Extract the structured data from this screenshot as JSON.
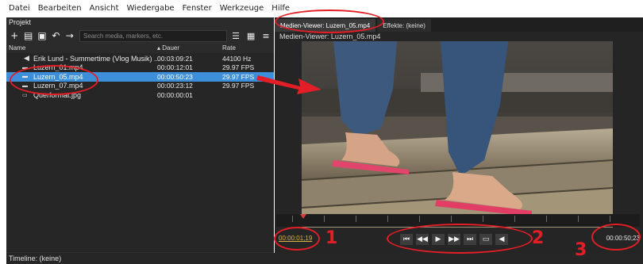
{
  "menu": [
    "Datei",
    "Bearbeiten",
    "Ansicht",
    "Wiedergabe",
    "Fenster",
    "Werkzeuge",
    "Hilfe"
  ],
  "project": {
    "title": "Projekt",
    "search_placeholder": "Search media, markers, etc.",
    "columns": {
      "name": "Name",
      "duration": "Dauer",
      "rate": "Rate"
    },
    "items": [
      {
        "icon": "audio-icon",
        "name": "Erik Lund - Summertime (Vlog Musik) ...",
        "duration": "00:03:09:21",
        "rate": "44100 Hz",
        "selected": false
      },
      {
        "icon": "video-icon",
        "name": "Luzern_01.mp4",
        "duration": "00:00:12:01",
        "rate": "29.97 FPS",
        "selected": false
      },
      {
        "icon": "video-icon",
        "name": "Luzern_05.mp4",
        "duration": "00:00:50:23",
        "rate": "29.97 FPS",
        "selected": true
      },
      {
        "icon": "video-icon",
        "name": "Luzern_07.mp4",
        "duration": "00:00:23:12",
        "rate": "29.97 FPS",
        "selected": false
      },
      {
        "icon": "image-icon",
        "name": "Querformat.jpg",
        "duration": "00:00:00:01",
        "rate": "",
        "selected": false
      }
    ]
  },
  "viewer": {
    "tabs": [
      {
        "label": "Medien-Viewer: Luzern_05.mp4",
        "active": true
      },
      {
        "label": "Effekte: (keine)",
        "active": false
      }
    ],
    "title": "Medien-Viewer: Luzern_05.mp4",
    "timecode_current": "00:00:01;19",
    "timecode_total": "00:00:50;23"
  },
  "timeline": {
    "label": "Timeline: (keine)"
  },
  "annotations": {
    "n1": "1",
    "n2": "2",
    "n3": "3"
  },
  "colors": {
    "accent_select": "#3e8fd9",
    "annotation": "#e41e26",
    "timecode": "#d6b44a"
  }
}
